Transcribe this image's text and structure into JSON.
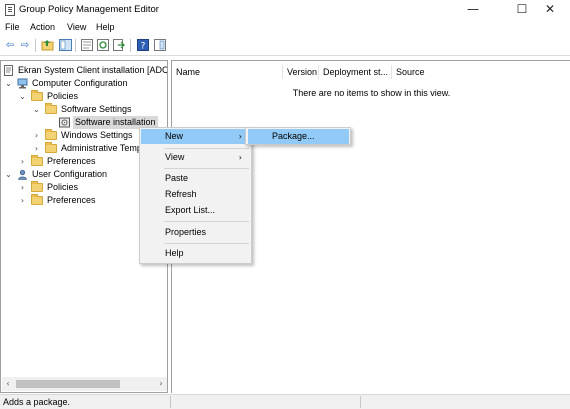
{
  "window": {
    "title": "Group Policy Management Editor",
    "minimize_glyph": "—",
    "maximize_glyph": "☐",
    "close_glyph": "✕"
  },
  "menubar": [
    "File",
    "Action",
    "View",
    "Help"
  ],
  "toolbar": {
    "buttons": [
      "back-icon",
      "forward-icon",
      "up-folder-icon",
      "show-hide-tree-icon",
      "properties-icon",
      "refresh-icon",
      "export-list-icon",
      "help-icon",
      "show-hide-action-pane-icon"
    ]
  },
  "tree": {
    "root": "Ekran System Client installation [ADC...",
    "computer_configuration": "Computer Configuration",
    "policies": "Policies",
    "software_settings": "Software Settings",
    "software_installation": "Software installation",
    "windows_settings": "Windows Settings",
    "administrative_templates": "Administrative Temp",
    "preferences": "Preferences",
    "user_configuration": "User Configuration",
    "user_policies": "Policies",
    "user_preferences": "Preferences"
  },
  "list": {
    "columns": [
      "Name",
      "Version",
      "Deployment st...",
      "Source"
    ],
    "empty_message": "There are no items to show in this view."
  },
  "context_menu": {
    "items": [
      "New",
      "View",
      "Paste",
      "Refresh",
      "Export List...",
      "Properties",
      "Help"
    ],
    "submenu_arrow": "›"
  },
  "submenu": {
    "items": [
      "Package..."
    ]
  },
  "status": {
    "text": "Adds a package."
  },
  "colors": {
    "highlight": "#91c9f7",
    "menu_bg": "#f2f2f2",
    "folder": "#f3d274"
  }
}
